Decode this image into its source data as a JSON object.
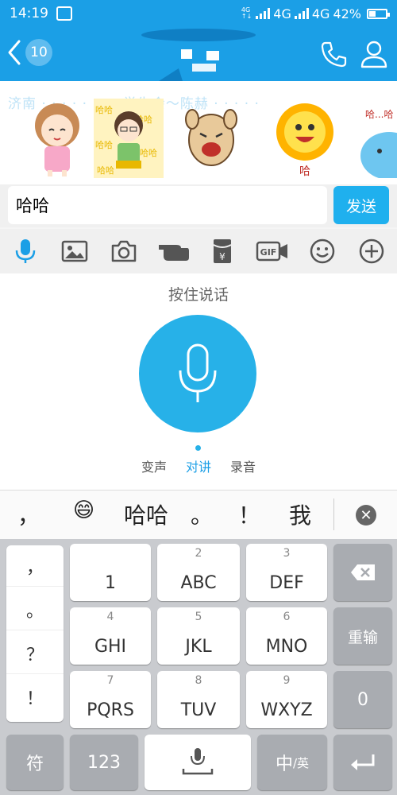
{
  "status_bar": {
    "time": "14:19",
    "network_1": "4G",
    "network_2": "4G",
    "battery": "42%",
    "battery_level": 0.42
  },
  "header": {
    "unread_count": "10"
  },
  "sticker_strip": {
    "items": [
      "girl-sticker",
      "boy-sticker",
      "alpaca-sticker",
      "sun-sticker",
      "blue-creature-sticker"
    ],
    "sun_caption": "哈",
    "partial_caption": "哈...哈"
  },
  "composer": {
    "input_value": "哈哈",
    "send_label": "发送"
  },
  "toolbar": {
    "icons": [
      "mic-icon",
      "image-icon",
      "camera-icon",
      "hand-icon",
      "red-packet-icon",
      "gif-icon",
      "emoji-icon",
      "plus-icon"
    ],
    "gif_label": "GIF",
    "yuan_label": "¥",
    "active_color": "#1b9fe6"
  },
  "voice_panel": {
    "hint": "按住说话",
    "modes": [
      "变声",
      "对讲",
      "录音"
    ],
    "active_mode": "对讲",
    "accent": "#27b1e8"
  },
  "candidates": {
    "items": [
      "，",
      "😄",
      "哈哈",
      "。",
      "！",
      "我"
    ]
  },
  "keyboard": {
    "punctuation": [
      "，",
      "。",
      "？",
      "！"
    ],
    "keys": [
      {
        "num": "",
        "label": "1"
      },
      {
        "num": "2",
        "label": "ABC"
      },
      {
        "num": "3",
        "label": "DEF"
      },
      {
        "num": "4",
        "label": "GHI"
      },
      {
        "num": "5",
        "label": "JKL"
      },
      {
        "num": "6",
        "label": "MNO"
      },
      {
        "num": "7",
        "label": "PQRS"
      },
      {
        "num": "8",
        "label": "TUV"
      },
      {
        "num": "9",
        "label": "WXYZ"
      }
    ],
    "reenter": "重输",
    "zero": "0",
    "symbols": "符",
    "numbers": "123",
    "lang_main": "中",
    "lang_alt": "/英"
  }
}
